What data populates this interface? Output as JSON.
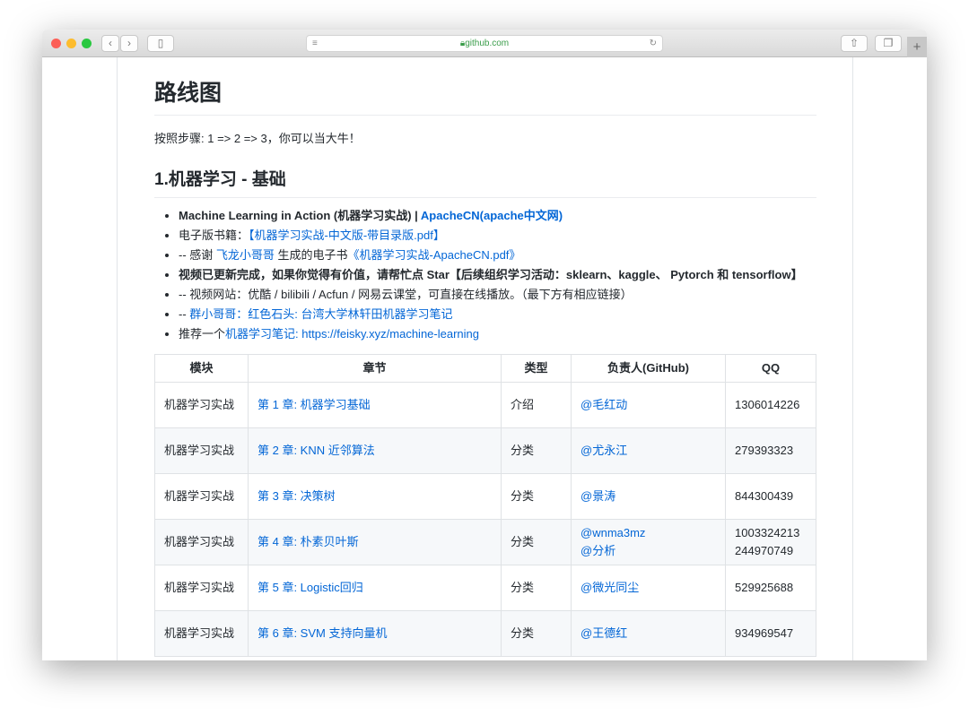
{
  "browser": {
    "url": "github.com"
  },
  "page": {
    "title": "路线图",
    "intro": "按照步骤: 1 => 2 => 3，你可以当大牛！",
    "section_title": "1.机器学习 - 基础",
    "items": [
      {
        "text": "Machine Learning in Action (机器学习实战) | ",
        "link": "ApacheCN(apache中文网)"
      },
      {
        "text": "电子版书籍：",
        "link": "【机器学习实战-中文版-带目录版.pdf】"
      },
      {
        "text": "-- 感谢 ",
        "link": "飞龙小哥哥",
        "text2": " 生成的电子书",
        "link2": "《机器学习实战-ApacheCN.pdf》"
      },
      {
        "text": "视频已更新完成，如果你觉得有价值，请帮忙点 Star【后续组织学习活动：sklearn、kaggle、 Pytorch 和 tensorflow】"
      },
      {
        "text": "-- 视频网站：优酷 / bilibili / Acfun / 网易云课堂，可直接在线播放。（最下方有相应链接）"
      },
      {
        "text": "-- ",
        "link": "群小哥哥：红色石头: 台湾大学林轩田机器学习笔记"
      },
      {
        "text": "推荐一个",
        "link": "机器学习笔记",
        "link2": ": https://feisky.xyz/machine-learning"
      }
    ],
    "table": {
      "headers": [
        "模块",
        "章节",
        "类型",
        "负责人(GitHub)",
        "QQ"
      ],
      "rows": [
        [
          "机器学习实战",
          "第 1 章: 机器学习基础",
          "介绍",
          "@毛红动",
          "1306014226"
        ],
        [
          "机器学习实战",
          "第 2 章: KNN 近邻算法",
          "分类",
          "@尤永江",
          "279393323"
        ],
        [
          "机器学习实战",
          "第 3 章: 决策树",
          "分类",
          "@景涛",
          "844300439"
        ],
        [
          "机器学习实战",
          "第 4 章: 朴素贝叶斯",
          "分类",
          "@wnma3mz\n@分析",
          "1003324213\n244970749"
        ],
        [
          "机器学习实战",
          "第 5 章: Logistic回归",
          "分类",
          "@微光同尘",
          "529925688"
        ],
        [
          "机器学习实战",
          "第 6 章: SVM 支持向量机",
          "分类",
          "@王德红",
          "934969547"
        ]
      ]
    }
  }
}
